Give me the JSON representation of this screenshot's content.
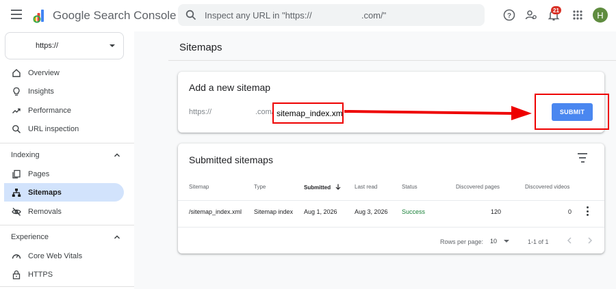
{
  "header": {
    "app_title": "Google Search Console",
    "search_placeholder": "Inspect any URL in \"https://                    .com/\"",
    "notification_count": "21",
    "avatar_initial": "H"
  },
  "sidebar": {
    "property": "https://",
    "items": [
      {
        "label": "Overview",
        "icon": "home-icon"
      },
      {
        "label": "Insights",
        "icon": "lightbulb-icon"
      },
      {
        "label": "Performance",
        "icon": "trending-up-icon"
      },
      {
        "label": "URL inspection",
        "icon": "search-icon"
      }
    ],
    "sections": [
      {
        "title": "Indexing",
        "items": [
          {
            "label": "Pages",
            "icon": "pages-icon"
          },
          {
            "label": "Sitemaps",
            "icon": "sitemap-icon",
            "active": true
          },
          {
            "label": "Removals",
            "icon": "visibility-off-icon"
          }
        ]
      },
      {
        "title": "Experience",
        "items": [
          {
            "label": "Core Web Vitals",
            "icon": "speed-icon"
          },
          {
            "label": "HTTPS",
            "icon": "lock-icon"
          }
        ]
      }
    ]
  },
  "main": {
    "page_title": "Sitemaps",
    "add_card": {
      "title": "Add a new sitemap",
      "url_prefix": "https://",
      "url_domain": ".com/",
      "input_value": "sitemap_index.xml",
      "submit_label": "SUBMIT"
    },
    "submitted_card": {
      "title": "Submitted sitemaps",
      "columns": [
        "Sitemap",
        "Type",
        "Submitted",
        "Last read",
        "Status",
        "Discovered pages",
        "Discovered videos"
      ],
      "rows": [
        {
          "sitemap": "/sitemap_index.xml",
          "type": "Sitemap index",
          "submitted": "Aug 1, 2026",
          "last_read": "Aug 3, 2026",
          "status": "Success",
          "discovered_pages": "120",
          "discovered_videos": "0"
        }
      ],
      "footer": {
        "rows_per_page_label": "Rows per page:",
        "rows_per_page_value": "10",
        "range": "1-1 of 1"
      }
    }
  },
  "colors": {
    "accent_blue": "#4a87f0",
    "active_nav": "#d2e3fc",
    "success_green": "#188038",
    "annotation_red": "#e00000"
  }
}
